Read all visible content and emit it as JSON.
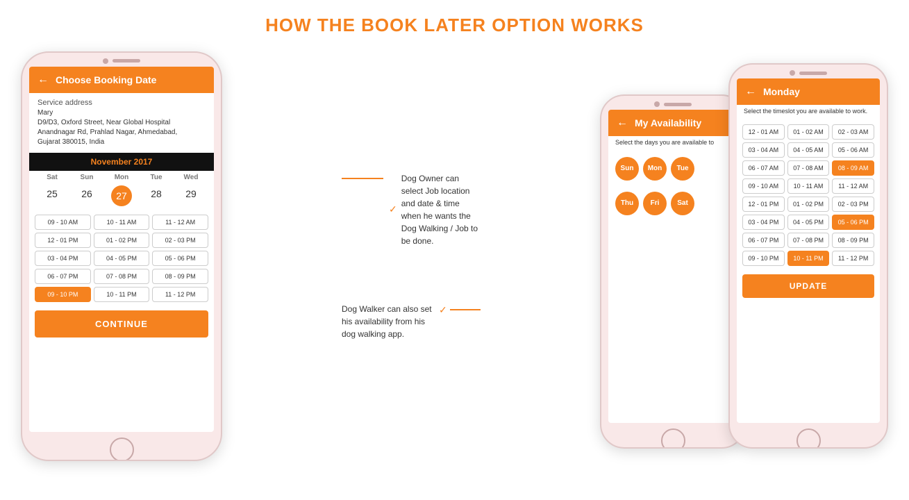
{
  "title": {
    "line1": "HOW THE BOOK LATER OPTION WORKS",
    "line2": ""
  },
  "phone_left": {
    "header": "Choose Booking Date",
    "service_address_label": "Service address",
    "address": "Mary\nD9/D3, Oxford Street, Near Global Hospital\nAnandnagar Rd, Prahlad Nagar, Ahmedabad,\nGujarat 380015, India",
    "calendar_month": "November 2017",
    "days": [
      "Sat",
      "Sun",
      "Mon",
      "Tue",
      "Wed"
    ],
    "dates": [
      "25",
      "26",
      "27",
      "28",
      "29"
    ],
    "active_date": "27",
    "time_slots": [
      {
        "label": "09 - 10 AM",
        "active": false
      },
      {
        "label": "10 - 11 AM",
        "active": false
      },
      {
        "label": "11 - 12 AM",
        "active": false
      },
      {
        "label": "12 - 01 PM",
        "active": false
      },
      {
        "label": "01 - 02 PM",
        "active": false
      },
      {
        "label": "02 - 03 PM",
        "active": false
      },
      {
        "label": "03 - 04 PM",
        "active": false
      },
      {
        "label": "04 - 05 PM",
        "active": false
      },
      {
        "label": "05 - 06 PM",
        "active": false
      },
      {
        "label": "06 - 07 PM",
        "active": false
      },
      {
        "label": "07 - 08 PM",
        "active": false
      },
      {
        "label": "08 - 09 PM",
        "active": false
      },
      {
        "label": "09 - 10 PM",
        "active": true
      },
      {
        "label": "10 - 11 PM",
        "active": false
      },
      {
        "label": "11 - 12 PM",
        "active": false
      }
    ],
    "continue_btn": "CONTINUE"
  },
  "annotation_1": {
    "text": "Dog Owner can select Job location and date & time when he wants the Dog Walking / Job to be done."
  },
  "annotation_2": {
    "text": "Dog Walker can also set his availability from his dog walking app."
  },
  "phone_availability": {
    "header": "My Availability",
    "description": "Select the days you are available to",
    "days": [
      "Sun",
      "Mon",
      "Tue",
      "Thu",
      "Fri",
      "Sat"
    ]
  },
  "phone_monday": {
    "header": "Monday",
    "description": "Select the timeslot you are available to work.",
    "time_slots": [
      {
        "label": "12 - 01 AM",
        "active": false
      },
      {
        "label": "01 - 02 AM",
        "active": false
      },
      {
        "label": "02 - 03 AM",
        "active": false
      },
      {
        "label": "03 - 04 AM",
        "active": false
      },
      {
        "label": "04 - 05 AM",
        "active": false
      },
      {
        "label": "05 - 06 AM",
        "active": false
      },
      {
        "label": "06 - 07 AM",
        "active": false
      },
      {
        "label": "07 - 08 AM",
        "active": false
      },
      {
        "label": "08 - 09 AM",
        "active": true
      },
      {
        "label": "09 - 10 AM",
        "active": false
      },
      {
        "label": "10 - 11 AM",
        "active": false
      },
      {
        "label": "11 - 12 AM",
        "active": false
      },
      {
        "label": "12 - 01 PM",
        "active": false
      },
      {
        "label": "01 - 02 PM",
        "active": false
      },
      {
        "label": "02 - 03 PM",
        "active": false
      },
      {
        "label": "03 - 04 PM",
        "active": false
      },
      {
        "label": "04 - 05 PM",
        "active": false
      },
      {
        "label": "05 - 06 PM",
        "active": true
      },
      {
        "label": "06 - 07 PM",
        "active": false
      },
      {
        "label": "07 - 08 PM",
        "active": false
      },
      {
        "label": "08 - 09 PM",
        "active": false
      },
      {
        "label": "09 - 10 PM",
        "active": false
      },
      {
        "label": "10 - 11 PM",
        "active": true
      },
      {
        "label": "11 - 12 PM",
        "active": false
      }
    ],
    "update_btn": "UPDATE"
  }
}
